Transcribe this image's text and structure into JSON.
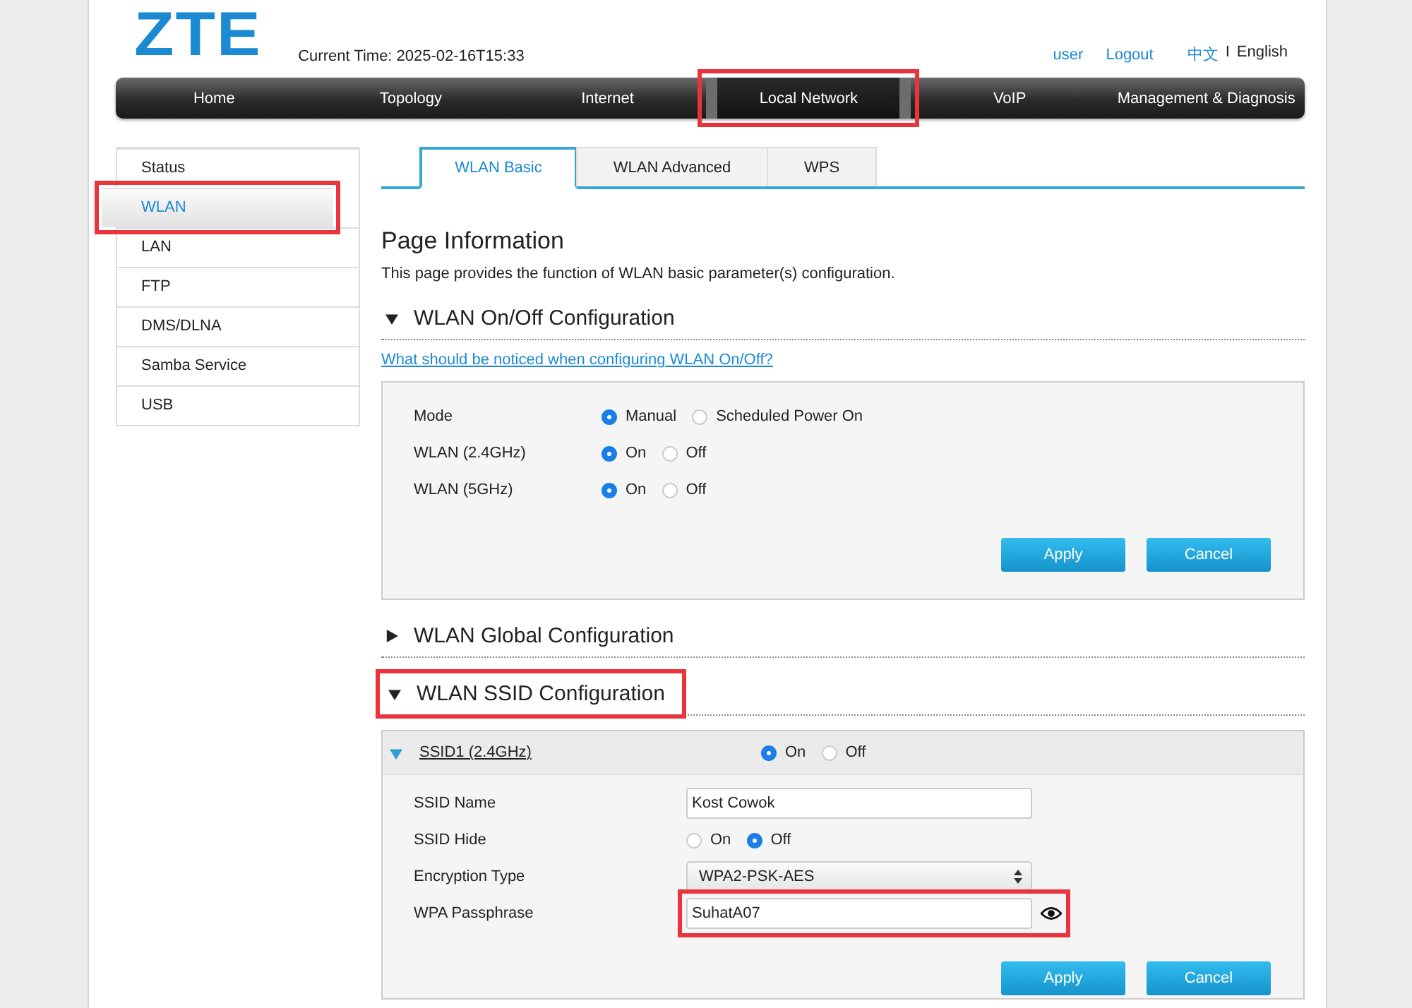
{
  "header": {
    "logo": "ZTE",
    "current_time_label": "Current Time:",
    "current_time": "2025-02-16T15:33",
    "links": [
      {
        "label": "user"
      },
      {
        "label": "Logout"
      }
    ],
    "languages": [
      {
        "label": "中文",
        "selected": false
      },
      {
        "label": "English",
        "selected": true
      }
    ],
    "separator": "I"
  },
  "nav": [
    {
      "label": "Home",
      "selected": false,
      "highlighted": false
    },
    {
      "label": "Topology",
      "selected": false,
      "highlighted": false
    },
    {
      "label": "Internet",
      "selected": false,
      "highlighted": false
    },
    {
      "label": "Local Network",
      "selected": true,
      "highlighted": true
    },
    {
      "label": "VoIP",
      "selected": false,
      "highlighted": false
    },
    {
      "label": "Management & Diagnosis",
      "selected": false,
      "highlighted": false
    }
  ],
  "sidebar": [
    {
      "label": "Status",
      "selected": false,
      "highlighted": false
    },
    {
      "label": "WLAN",
      "selected": true,
      "highlighted": true
    },
    {
      "label": "LAN",
      "selected": false,
      "highlighted": false
    },
    {
      "label": "FTP",
      "selected": false,
      "highlighted": false
    },
    {
      "label": "DMS/DLNA",
      "selected": false,
      "highlighted": false
    },
    {
      "label": "Samba Service",
      "selected": false,
      "highlighted": false
    },
    {
      "label": "USB",
      "selected": false,
      "highlighted": false
    }
  ],
  "tabs": [
    {
      "label": "WLAN Basic",
      "selected": true
    },
    {
      "label": "WLAN Advanced",
      "selected": false
    },
    {
      "label": "WPS",
      "selected": false
    }
  ],
  "page_info": {
    "title": "Page Information",
    "description": "This page provides the function of WLAN basic parameter(s) configuration."
  },
  "sections": [
    {
      "title": "WLAN On/Off Configuration",
      "expanded": true,
      "highlighted": false,
      "help_link": "What should be noticed when configuring WLAN On/Off?",
      "panel": {
        "rows": [
          {
            "label": "Mode",
            "kind": "radio",
            "options": [
              {
                "label": "Manual",
                "selected": true
              },
              {
                "label": "Scheduled Power On",
                "selected": false
              }
            ]
          },
          {
            "label": "WLAN (2.4GHz)",
            "kind": "radio",
            "options": [
              {
                "label": "On",
                "selected": true
              },
              {
                "label": "Off",
                "selected": false
              }
            ]
          },
          {
            "label": "WLAN (5GHz)",
            "kind": "radio",
            "options": [
              {
                "label": "On",
                "selected": true
              },
              {
                "label": "Off",
                "selected": false
              }
            ]
          }
        ],
        "buttons": [
          "Apply",
          "Cancel"
        ]
      }
    },
    {
      "title": "WLAN Global Configuration",
      "expanded": false,
      "highlighted": false
    },
    {
      "title": "WLAN SSID Configuration",
      "expanded": true,
      "highlighted": true,
      "ssids": [
        {
          "name": "SSID1 (2.4GHz)",
          "expanded": true,
          "options": [
            {
              "label": "On",
              "selected": true
            },
            {
              "label": "Off",
              "selected": false
            }
          ],
          "rows": [
            {
              "label": "SSID Name",
              "kind": "text",
              "value": "Kost Cowok",
              "highlighted": false
            },
            {
              "label": "SSID Hide",
              "kind": "radio",
              "options": [
                {
                  "label": "On",
                  "selected": false
                },
                {
                  "label": "Off",
                  "selected": true
                }
              ]
            },
            {
              "label": "Encryption Type",
              "kind": "select",
              "value": "WPA2-PSK-AES"
            },
            {
              "label": "WPA Passphrase",
              "kind": "password",
              "value": "SuhatA07",
              "highlighted": true
            }
          ],
          "buttons": [
            "Apply",
            "Cancel"
          ]
        }
      ]
    }
  ]
}
